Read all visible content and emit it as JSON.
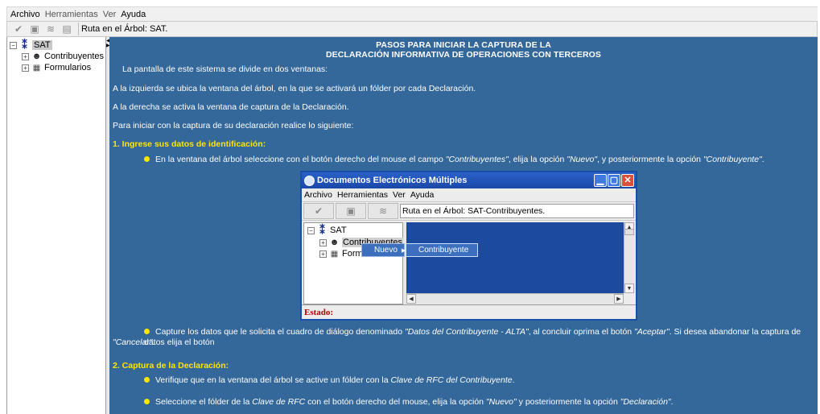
{
  "menubar": {
    "items": [
      "Archivo",
      "Herramientas",
      "Ver",
      "Ayuda"
    ]
  },
  "toolbar": {
    "buttons": [
      "check-icon",
      "print-icon",
      "stack-icon",
      "list-icon"
    ],
    "path_text": "Ruta en el Árbol: SAT."
  },
  "tree": {
    "root": "SAT",
    "children": [
      "Contribuyentes",
      "Formularios"
    ]
  },
  "content": {
    "title_line1": "PASOS PARA INICIAR LA CAPTURA DE LA",
    "title_line2": "DECLARACIÓN INFORMATIVA DE OPERACIONES CON TERCEROS",
    "p1": "La pantalla de este sistema se divide en dos ventanas:",
    "p2": "A la izquierda se ubica la ventana del árbol, en la que se activará un fólder por cada Declaración.",
    "p3": "A la derecha se activa la ventana de captura de la Declaración.",
    "p4": "Para iniciar con la captura de su declaración realice lo siguiente:",
    "h1": "1. Ingrese sus datos de identificación:",
    "b1": {
      "t1": "En la ventana del árbol seleccione con el botón derecho del mouse el campo ",
      "i1": "\"Contribuyentes\"",
      "t2": ", elija la opción ",
      "i2": "\"Nuevo\"",
      "t3": ", y posteriormente la opción ",
      "i3": "\"Contribuyente\"",
      "t4": "."
    },
    "b2": {
      "t1": "Capture los datos que le solicita el cuadro de diálogo denominado ",
      "i1": "\"Datos del Contribuyente - ALTA\"",
      "t2": ", al concluir oprima el botón ",
      "i2": "\"Aceptar\"",
      "t3": ". Si desea abandonar la captura de datos elija el botón",
      "i3": "\"Cancelar\"",
      "t4": "."
    },
    "h2": "2. Captura de la Declaración:",
    "b3": {
      "t1": "Verifique que en la ventana del árbol se active un fólder con la ",
      "i1": "Clave de RFC del Contribuyente",
      "t2": "."
    },
    "b4": {
      "t1": "Seleccione el fólder de la ",
      "i1": "Clave de RFC",
      "t2": " con el botón derecho del mouse, elija la opción ",
      "i2": "\"Nuevo\"",
      "t3": " y posteriormente la opción ",
      "i3": "\"Declaración\"",
      "t4": "."
    }
  },
  "dialog": {
    "title": "Documentos Electrónicos Múltiples",
    "menu": [
      "Archivo",
      "Herramientas",
      "Ver",
      "Ayuda"
    ],
    "path_text": "Ruta en el Árbol: SAT-Contribuyentes.",
    "tree_root": "SAT",
    "tree_child1": "Contribuyentes",
    "tree_child2": "Formu",
    "ctx_item": "Nuevo",
    "submenu_item": "Contribuyente",
    "status": "Estado:"
  },
  "colors": {
    "content_bg": "#34679a",
    "heading_yellow": "#ffe600",
    "dialog_title_blue": "#1b48a8",
    "status_red": "#b00000"
  }
}
